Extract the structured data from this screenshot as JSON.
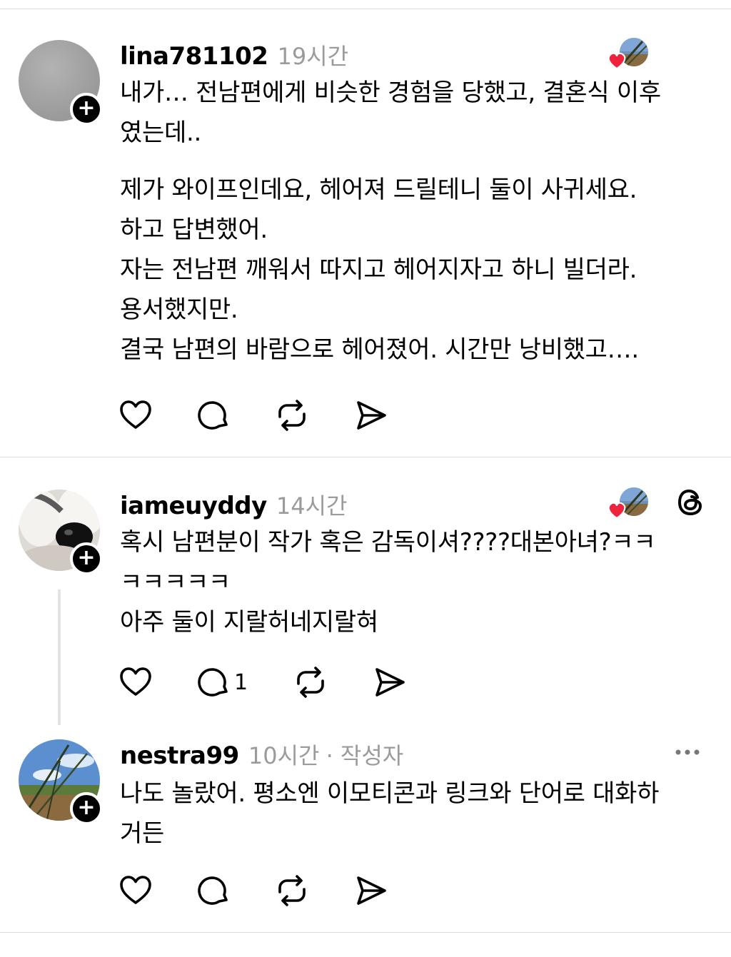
{
  "posts": [
    {
      "username": "lina781102",
      "time": "19시간",
      "lines": [
        "내가… 전남편에게 비슷한 경험을 당했고, 결혼식 이후",
        "였는데..",
        "",
        "제가 와이프인데요, 헤어져 드릴테니 둘이 사귀세요.",
        "하고 답변했어.",
        "자는 전남편 깨워서 따지고 헤어지자고 하니 빌더라.",
        "용서했지만.",
        "결국 남편의 바람으로 헤어졌어. 시간만 낭비했고…."
      ],
      "reply_count": ""
    },
    {
      "username": "iameuyddy",
      "time": "14시간",
      "lines": [
        "혹시 남편분이 작가 혹은 감독이셔????대본아녀?ㅋㅋ",
        "ㅋㅋㅋㅋㅋ",
        "아주 둘이 지랄허네지랄혀"
      ],
      "reply_count": "1"
    },
    {
      "username": "nestra99",
      "time": "10시간",
      "author_tag": "· 작성자",
      "lines": [
        "나도 놀랐어. 평소엔 이모티콘과 링크와 단어로 대화하",
        "거든"
      ],
      "reply_count": ""
    }
  ],
  "icons": {
    "like": "heart-outline-icon",
    "reply": "speech-bubble-icon",
    "repost": "repost-icon",
    "share": "send-icon",
    "threads": "threads-logo-icon",
    "more": "more-dots-icon"
  },
  "colors": {
    "heart": "#f0233f",
    "meta_gray": "#9b9b9b"
  }
}
